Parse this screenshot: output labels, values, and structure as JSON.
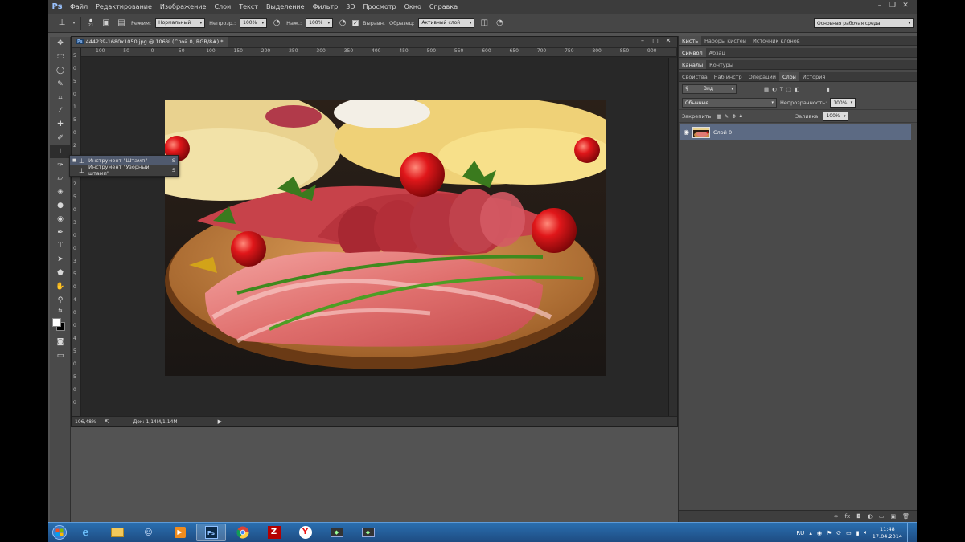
{
  "app": {
    "logo": "Ps",
    "menu": [
      "Файл",
      "Редактирование",
      "Изображение",
      "Слои",
      "Текст",
      "Выделение",
      "Фильтр",
      "3D",
      "Просмотр",
      "Окно",
      "Справка"
    ],
    "window_controls": [
      "minimize",
      "restore",
      "close"
    ]
  },
  "options_bar": {
    "brush_size": "21",
    "mode_label": "Режим:",
    "mode_value": "Нормальный",
    "opacity_label": "Непрозр.:",
    "opacity_value": "100%",
    "pressure_label": "Наж.:",
    "pressure_value": "100%",
    "aligned_label": "Выравн.",
    "sample_label": "Образец:",
    "sample_value": "Активный слой",
    "workspace": "Основная рабочая среда"
  },
  "document": {
    "tab_title": "444239-1680x1050.jpg @ 106% (Слой 0, RGB/8#) *",
    "ruler_top": [
      "100",
      "50",
      "0",
      "50",
      "100",
      "150",
      "200",
      "250",
      "300",
      "350",
      "400",
      "450",
      "500",
      "550",
      "600",
      "650",
      "700",
      "750",
      "800",
      "850",
      "900"
    ],
    "ruler_left": [
      "5",
      "0",
      "5",
      "0",
      "1",
      "5",
      "0",
      "2",
      "0",
      "0",
      "2",
      "5",
      "0",
      "3",
      "0",
      "0",
      "3",
      "5",
      "0",
      "4",
      "0",
      "0",
      "4",
      "5",
      "0",
      "5",
      "0",
      "0"
    ],
    "zoom": "106,48%",
    "doc_size": "Док: 1,14M/1,14M"
  },
  "flyout": {
    "items": [
      {
        "label": "Инструмент \"Штамп\"",
        "key": "S",
        "selected": true
      },
      {
        "label": "Инструмент \"Узорный штамп\"",
        "key": "S",
        "selected": false
      }
    ]
  },
  "panels": {
    "group1_tabs": [
      "Кисть",
      "Наборы кистей",
      "Источник клонов"
    ],
    "group2_tabs": [
      "Символ",
      "Абзац"
    ],
    "group3_tabs": [
      "Каналы",
      "Контуры"
    ],
    "layers_tabs": [
      "Свойства",
      "Наб.инстр",
      "Операции",
      "Слои",
      "История"
    ],
    "filter_kind": "Вид",
    "blend_mode": "Обычные",
    "opacity_label": "Непрозрачность:",
    "opacity_value": "100%",
    "lock_label": "Закрепить:",
    "fill_label": "Заливка:",
    "fill_value": "100%",
    "layer_name": "Слой 0"
  },
  "taskbar": {
    "lang": "RU",
    "time": "11:48",
    "date": "17.04.2014"
  },
  "colors": {
    "ui_bg": "#535353",
    "panel_bg": "#4a4a4a",
    "selected_layer": "#5c6a83",
    "taskbar": "#1e4c82"
  }
}
